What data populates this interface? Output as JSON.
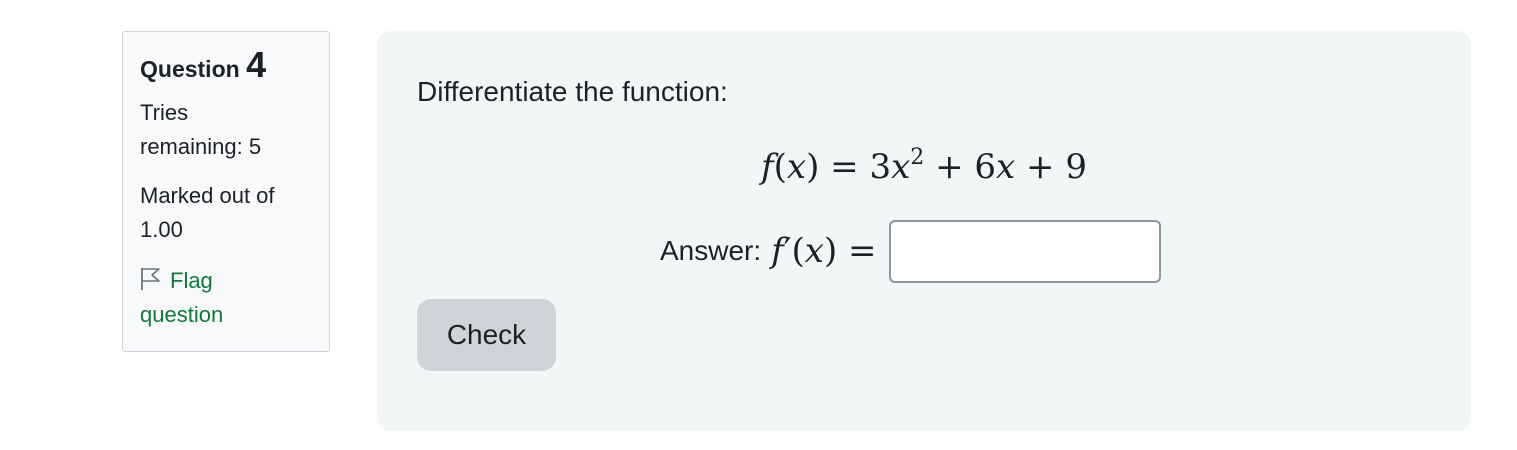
{
  "info": {
    "question_word": "Question",
    "question_number": "4",
    "tries_line1": "Tries",
    "tries_line2": "remaining: 5",
    "marked_line1": "Marked out of",
    "marked_line2": "1.00",
    "flag_line1": "Flag",
    "flag_line2": "question",
    "flag_icon": "flag-outline-icon",
    "link_color": "#0f7a3a"
  },
  "question": {
    "prompt": "Differentiate the function:",
    "equation": {
      "lhs_f": "f",
      "lhs_paren_open": "(",
      "lhs_x": "x",
      "lhs_paren_close": ")",
      "equals": " = ",
      "coef_a": "3",
      "var_a": "x",
      "exp_a": "2",
      "plus1": " + ",
      "coef_b": "6",
      "var_b": "x",
      "plus2": " + ",
      "const": "9"
    },
    "answer_label": "Answer:",
    "answer_math": {
      "f": "f",
      "prime": "′",
      "paren_open": "(",
      "x": "x",
      "paren_close": ")",
      "equals": " ="
    },
    "answer_value": "",
    "answer_placeholder": "",
    "check_label": "Check"
  },
  "colors": {
    "content_bg": "#f1f6f6",
    "info_bg": "#f8f9fa",
    "button_bg": "#ced4da"
  }
}
